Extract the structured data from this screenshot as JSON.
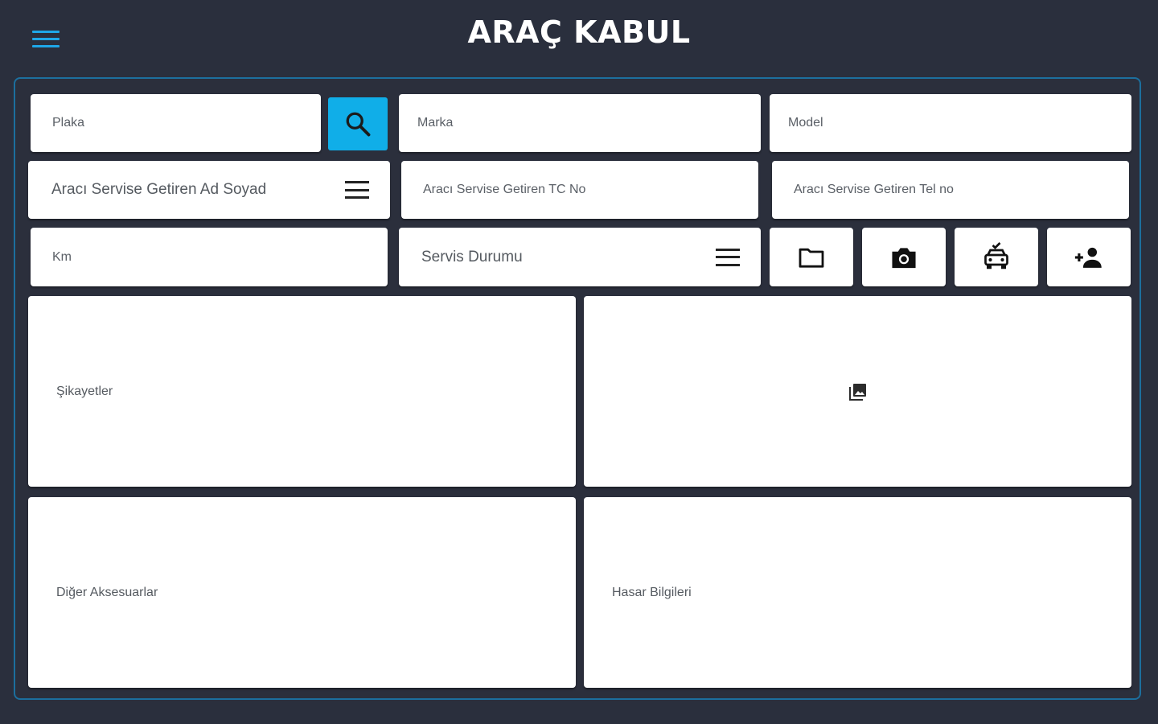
{
  "header": {
    "title": "ARAÇ KABUL",
    "menu_icon": "hamburger-menu-icon"
  },
  "form": {
    "plaka": {
      "placeholder": "Plaka"
    },
    "marka": {
      "placeholder": "Marka"
    },
    "model": {
      "placeholder": "Model"
    },
    "getiren_ad": {
      "label": "Aracı Servise Getiren Ad Soyad",
      "icon": "list-icon"
    },
    "getiren_tc": {
      "placeholder": "Aracı Servise Getiren TC No"
    },
    "getiren_tel": {
      "placeholder": "Aracı Servise Getiren Tel no"
    },
    "km": {
      "placeholder": "Km"
    },
    "servis_durumu": {
      "label": "Servis Durumu",
      "icon": "list-icon"
    },
    "sikayetler": {
      "placeholder": "Şikayetler"
    },
    "diger_aksesuarlar": {
      "placeholder": "Diğer Aksesuarlar"
    },
    "hasar_bilgileri": {
      "placeholder": "Hasar Bilgileri"
    }
  },
  "actions": {
    "search": "search-icon",
    "folder": "folder-icon",
    "camera": "camera-icon",
    "car": "car-check-icon",
    "add_person": "person-add-icon",
    "image": "photo-library-icon"
  },
  "colors": {
    "background": "#2a2f3d",
    "accent": "#10aee8",
    "panel_border": "#1c6f9e"
  }
}
